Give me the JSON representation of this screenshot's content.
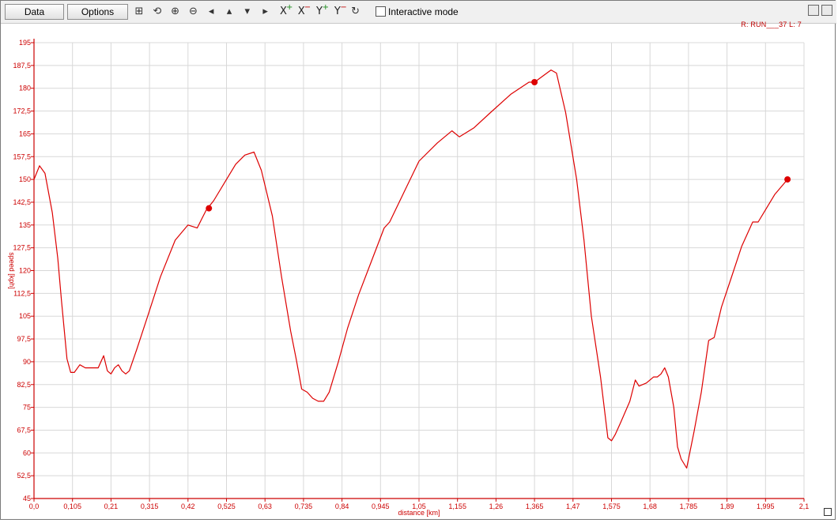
{
  "toolbar": {
    "data_label": "Data",
    "options_label": "Options",
    "interactive_label": "Interactive mode",
    "interactive_checked": false,
    "icons": [
      "zoom-box-icon",
      "zoom-reset-icon",
      "zoom-in-icon",
      "zoom-out-icon",
      "pan-left-icon",
      "pan-up-icon",
      "pan-down-icon",
      "pan-right-icon",
      "x-zoom-in-icon",
      "x-zoom-out-icon",
      "y-zoom-in-icon",
      "y-zoom-out-icon",
      "refresh-icon"
    ]
  },
  "run_label": "R: RUN___37  L: 7",
  "colors": {
    "series": "#dd0000",
    "axis": "#cc0000",
    "grid": "#d8d8d8"
  },
  "chart_data": {
    "type": "line",
    "xlabel": "distance [km]",
    "ylabel": "speed [kph]",
    "xlim": [
      0,
      2.1
    ],
    "ylim": [
      45,
      195
    ],
    "xticks": [
      "0,0",
      "0,105",
      "0,21",
      "0,315",
      "0,42",
      "0,525",
      "0,63",
      "0,735",
      "0,84",
      "0,945",
      "1,05",
      "1,155",
      "1,26",
      "1,365",
      "1,47",
      "1,575",
      "1,68",
      "1,785",
      "1,89",
      "1,995",
      "2,1"
    ],
    "yticks": [
      "45",
      "52,5",
      "60",
      "67,5",
      "75",
      "82,5",
      "90",
      "97,5",
      "105",
      "112,5",
      "120",
      "127,5",
      "135",
      "142,5",
      "150",
      "157,5",
      "165",
      "172,5",
      "180",
      "187,5",
      "195"
    ],
    "grid": true,
    "series": [
      {
        "x": [
          0.0,
          0.015,
          0.03,
          0.05,
          0.065,
          0.075,
          0.09,
          0.1,
          0.11,
          0.125,
          0.14,
          0.16,
          0.175,
          0.19,
          0.2,
          0.21,
          0.22,
          0.23,
          0.24,
          0.25,
          0.26,
          0.28,
          0.31,
          0.345,
          0.385,
          0.42,
          0.445,
          0.47,
          0.49,
          0.52,
          0.55,
          0.575,
          0.6,
          0.62,
          0.65,
          0.675,
          0.7,
          0.715,
          0.73,
          0.745,
          0.76,
          0.775,
          0.79,
          0.805,
          0.83,
          0.855,
          0.885,
          0.92,
          0.955,
          0.97,
          1.01,
          1.05,
          1.1,
          1.14,
          1.16,
          1.2,
          1.245,
          1.3,
          1.35,
          1.365,
          1.41,
          1.425,
          1.45,
          1.48,
          1.5,
          1.52,
          1.545,
          1.565,
          1.575,
          1.585,
          1.6,
          1.625,
          1.64,
          1.65,
          1.67,
          1.69,
          1.7,
          1.71,
          1.72,
          1.73,
          1.745,
          1.755,
          1.765,
          1.78,
          1.8,
          1.82,
          1.84,
          1.855,
          1.875,
          1.9,
          1.93,
          1.96,
          1.975,
          1.995,
          2.02,
          2.055
        ],
        "y": [
          150,
          154.5,
          152,
          139,
          124,
          110,
          91,
          86.5,
          86.5,
          89,
          88,
          88,
          88,
          92,
          87,
          86,
          88,
          89,
          87,
          86,
          87,
          94,
          105,
          118,
          130,
          135,
          134,
          140,
          143,
          149,
          155,
          158,
          159,
          153,
          138,
          118,
          100,
          91,
          81,
          80,
          78,
          77,
          77,
          80,
          90,
          101,
          112,
          123,
          134,
          136,
          146,
          156,
          162,
          166,
          164,
          167,
          172,
          178,
          182,
          182,
          186,
          185,
          172,
          150,
          130,
          105,
          85,
          65,
          64,
          66,
          70,
          77,
          84,
          82,
          83,
          85,
          85,
          86,
          88,
          85,
          75,
          62,
          58,
          55,
          67,
          80,
          97,
          98,
          108,
          117,
          128,
          136,
          136,
          140,
          145,
          150
        ]
      }
    ],
    "markers": [
      {
        "x": 0.477,
        "y": 140.5
      },
      {
        "x": 1.365,
        "y": 182
      },
      {
        "x": 2.055,
        "y": 150
      }
    ]
  }
}
